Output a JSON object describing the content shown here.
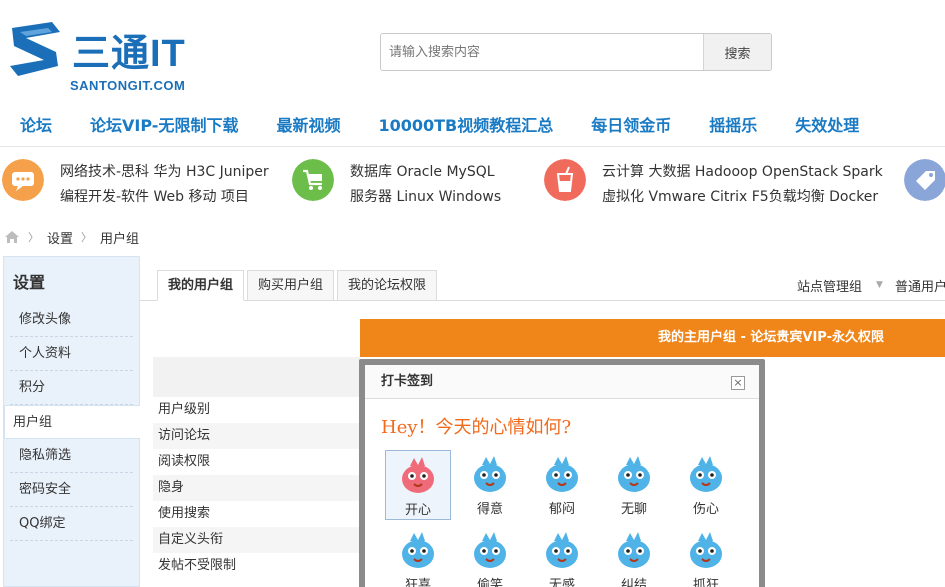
{
  "header": {
    "logo_text": "三通IT",
    "logo_sub": "SANTONGIT.COM",
    "search_placeholder": "请输入搜索内容",
    "search_button": "搜索"
  },
  "nav": [
    "论坛",
    "论坛VIP-无限制下载",
    "最新视频",
    "10000TB视频教程汇总",
    "每日领金币",
    "摇摇乐",
    "失效处理"
  ],
  "categories": [
    {
      "line1": "网络技术-思科 华为 H3C Juniper",
      "line2": "编程开发-软件 Web 移动 项目",
      "icon": "chat-icon",
      "color": "#f5a04a"
    },
    {
      "line1": "数据库 Oracle MySQL",
      "line2": "服务器 Linux Windows",
      "icon": "cart-icon",
      "color": "#6dbd4a"
    },
    {
      "line1": "云计算 大数据 Hadooop OpenStack Spark",
      "line2": "虚拟化 Vmware Citrix F5负载均衡 Docker",
      "icon": "cup-icon",
      "color": "#f06b5b"
    },
    {
      "icon": "tag-icon",
      "color": "#8aa6d9"
    }
  ],
  "breadcrumb": [
    "设置",
    "用户组"
  ],
  "sidebar": {
    "title": "设置",
    "items": [
      "修改头像",
      "个人资料",
      "积分",
      "用户组",
      "隐私筛选",
      "密码安全",
      "QQ绑定"
    ]
  },
  "tabs": [
    "我的用户组",
    "购买用户组",
    "我的论坛权限"
  ],
  "right_links": [
    "站点管理组",
    "普通用户"
  ],
  "orange_bar": "我的主用户组 - 论坛贵宾VIP-永久权限",
  "permissions": [
    "用户级别",
    "访问论坛",
    "阅读权限",
    "隐身",
    "使用搜索",
    "自定义头衔",
    "发帖不受限制"
  ],
  "modal": {
    "title": "打卡签到",
    "close": "×",
    "question": "Hey！今天的心情如何?",
    "moods": [
      "开心",
      "得意",
      "郁闷",
      "无聊",
      "伤心",
      "狂喜",
      "偷笑",
      "无感",
      "纠结",
      "抓狂"
    ]
  }
}
